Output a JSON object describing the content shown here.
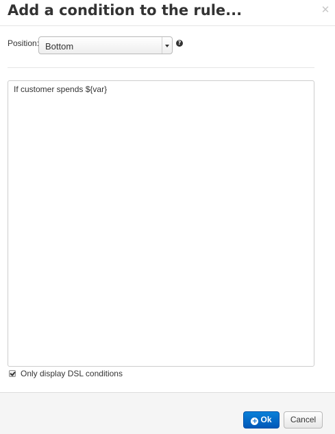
{
  "dialog": {
    "title": "Add a condition to the rule...",
    "close_icon": "close-icon"
  },
  "position": {
    "label": "Position:",
    "selected": "Bottom",
    "help_icon": "help-icon"
  },
  "conditions": {
    "items": [
      "If customer spends ${var}"
    ]
  },
  "dsl_only": {
    "label": "Only display DSL conditions",
    "checked": true
  },
  "footer": {
    "ok_label": "Ok",
    "cancel_label": "Cancel",
    "ok_icon": "plus-circle-icon"
  },
  "colors": {
    "primary": "#0a6cc8",
    "footer_bg": "#f5f5f5"
  }
}
